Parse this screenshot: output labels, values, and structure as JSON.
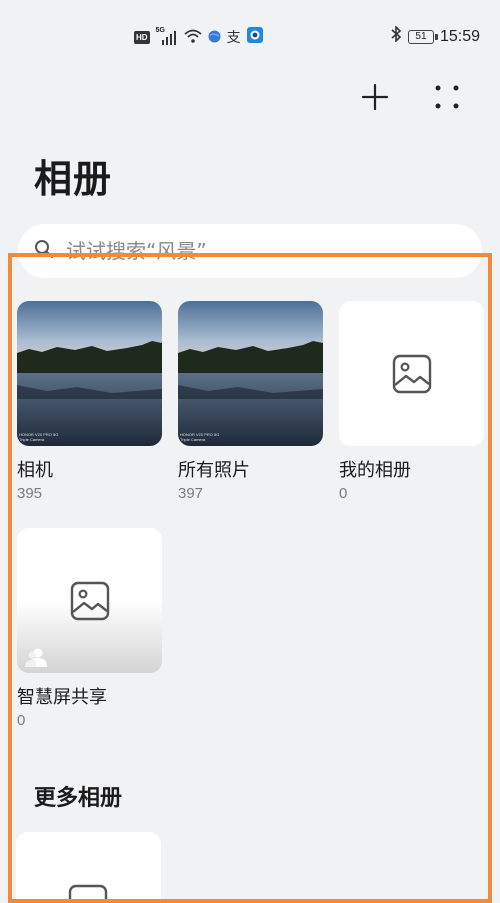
{
  "status_bar": {
    "hd_badge": "HD",
    "network": "5G",
    "battery": "51",
    "time": "15:59",
    "icons": [
      "hd-icon",
      "signal-icon",
      "wifi-icon",
      "globe-icon",
      "alipay-icon",
      "app-icon",
      "bluetooth-icon",
      "battery-icon"
    ]
  },
  "header": {
    "add_icon": "plus-icon",
    "more_icon": "more-dots-icon"
  },
  "page": {
    "title": "相册"
  },
  "search": {
    "placeholder": "试试搜索“风景”"
  },
  "albums": [
    {
      "name": "相机",
      "count": "395",
      "watermark_line1": "HONOR V20 PRO 5G",
      "watermark_line2": "Triple Camera"
    },
    {
      "name": "所有照片",
      "count": "397",
      "watermark_line1": "HONOR V20 PRO 5G",
      "watermark_line2": "Triple Camera"
    },
    {
      "name": "我的相册",
      "count": "0"
    },
    {
      "name": "智慧屏共享",
      "count": "0"
    }
  ],
  "more_section": {
    "title": "更多相册"
  },
  "colors": {
    "background": "#f1f2f4",
    "highlight": "#f28a3a",
    "card": "#ffffff"
  }
}
